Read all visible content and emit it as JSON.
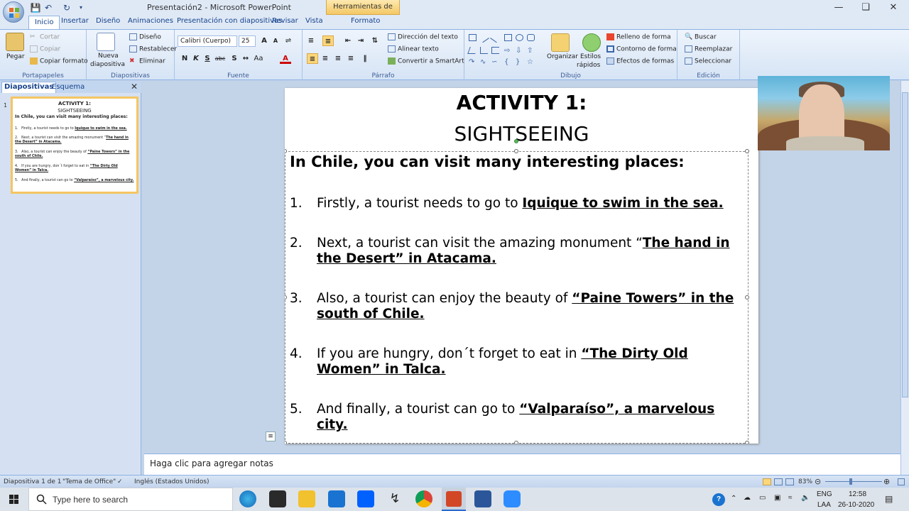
{
  "window": {
    "title": "Presentación2 - Microsoft PowerPoint",
    "contextual_tab": "Herramientas de dibujo"
  },
  "ribbon_tabs": [
    "Inicio",
    "Insertar",
    "Diseño",
    "Animaciones",
    "Presentación con diapositivas",
    "Revisar",
    "Vista",
    "Formato"
  ],
  "ribbon": {
    "portapapeles": {
      "label": "Portapapeles",
      "paste": "Pegar",
      "cut": "Cortar",
      "copy": "Copiar",
      "format_painter": "Copiar formato"
    },
    "diapositivas": {
      "label": "Diapositivas",
      "new_slide_1": "Nueva",
      "new_slide_2": "diapositiva",
      "layout": "Diseño",
      "reset": "Restablecer",
      "delete": "Eliminar"
    },
    "fuente": {
      "label": "Fuente",
      "font_name": "Calibri (Cuerpo)",
      "font_size": "25"
    },
    "parrafo": {
      "label": "Párrafo",
      "text_direction": "Dirección del texto",
      "align_text": "Alinear texto",
      "smartart": "Convertir a SmartArt"
    },
    "dibujo": {
      "label": "Dibujo",
      "arrange": "Organizar",
      "quick_styles_1": "Estilos",
      "quick_styles_2": "rápidos",
      "fill": "Relleno de forma",
      "outline": "Contorno de forma",
      "effects": "Efectos de formas"
    },
    "edicion": {
      "label": "Edición",
      "find": "Buscar",
      "replace": "Reemplazar",
      "select": "Seleccionar"
    }
  },
  "left_panel": {
    "tab_slides": "Diapositivas",
    "tab_outline": "Esquema",
    "slide_number": "1"
  },
  "slide": {
    "title": "ACTIVITY 1:",
    "subtitle": "SIGHTSEEING",
    "heading": "In Chile, you can visit many interesting places:",
    "items": [
      {
        "num": "1.",
        "text": "Firstly, a tourist needs to go to ",
        "bold": "Iquique to swim in the sea."
      },
      {
        "num": "2.",
        "text": "Next, a tourist can visit the amazing monument “",
        "bold": "The hand in the Desert” in Atacama."
      },
      {
        "num": "3.",
        "text": "Also, a tourist can enjoy the beauty of ",
        "bold": "“Paine Towers” in the south of Chile."
      },
      {
        "num": "4.",
        "text": "If you are hungry, don´t forget to eat in ",
        "bold": "“The Dirty Old Women” in Talca."
      },
      {
        "num": "5.",
        "text": "And finally, a tourist can go to ",
        "bold": "“Valparaíso”, a marvelous city."
      }
    ]
  },
  "thumbnail": {
    "title": "ACTIVITY 1:",
    "subtitle": "SIGHTSEEING",
    "heading": "In Chile, you can visit many interesting places:",
    "items": [
      {
        "num": "1.",
        "text": "Firstly, a tourist needs to go to ",
        "bold": "Iquique to swim in the sea."
      },
      {
        "num": "2.",
        "text": "Next, a tourist can visit the amazing monument “",
        "bold": "The hand in the Desert” in Atacama."
      },
      {
        "num": "3.",
        "text": "Also, a tourist can enjoy the beauty of ",
        "bold": "“Paine Towers” in the south of Chile."
      },
      {
        "num": "4.",
        "text": "If you are hungry, don´t forget to eat in ",
        "bold": "“The Dirty Old Women” in Talca."
      },
      {
        "num": "5.",
        "text": "And finally, a tourist can go to ",
        "bold": "“Valparaíso”, a marvelous city."
      }
    ]
  },
  "notes_placeholder": "Haga clic para agregar notas",
  "status": {
    "slide_info": "Diapositiva 1 de 1",
    "theme": "\"Tema de Office\"",
    "language": "Inglés (Estados Unidos)",
    "zoom": "83%"
  },
  "taskbar": {
    "search_placeholder": "Type here to search",
    "lang1": "ENG",
    "lang2": "LAA",
    "time": "12:58",
    "date": "26-10-2020"
  }
}
